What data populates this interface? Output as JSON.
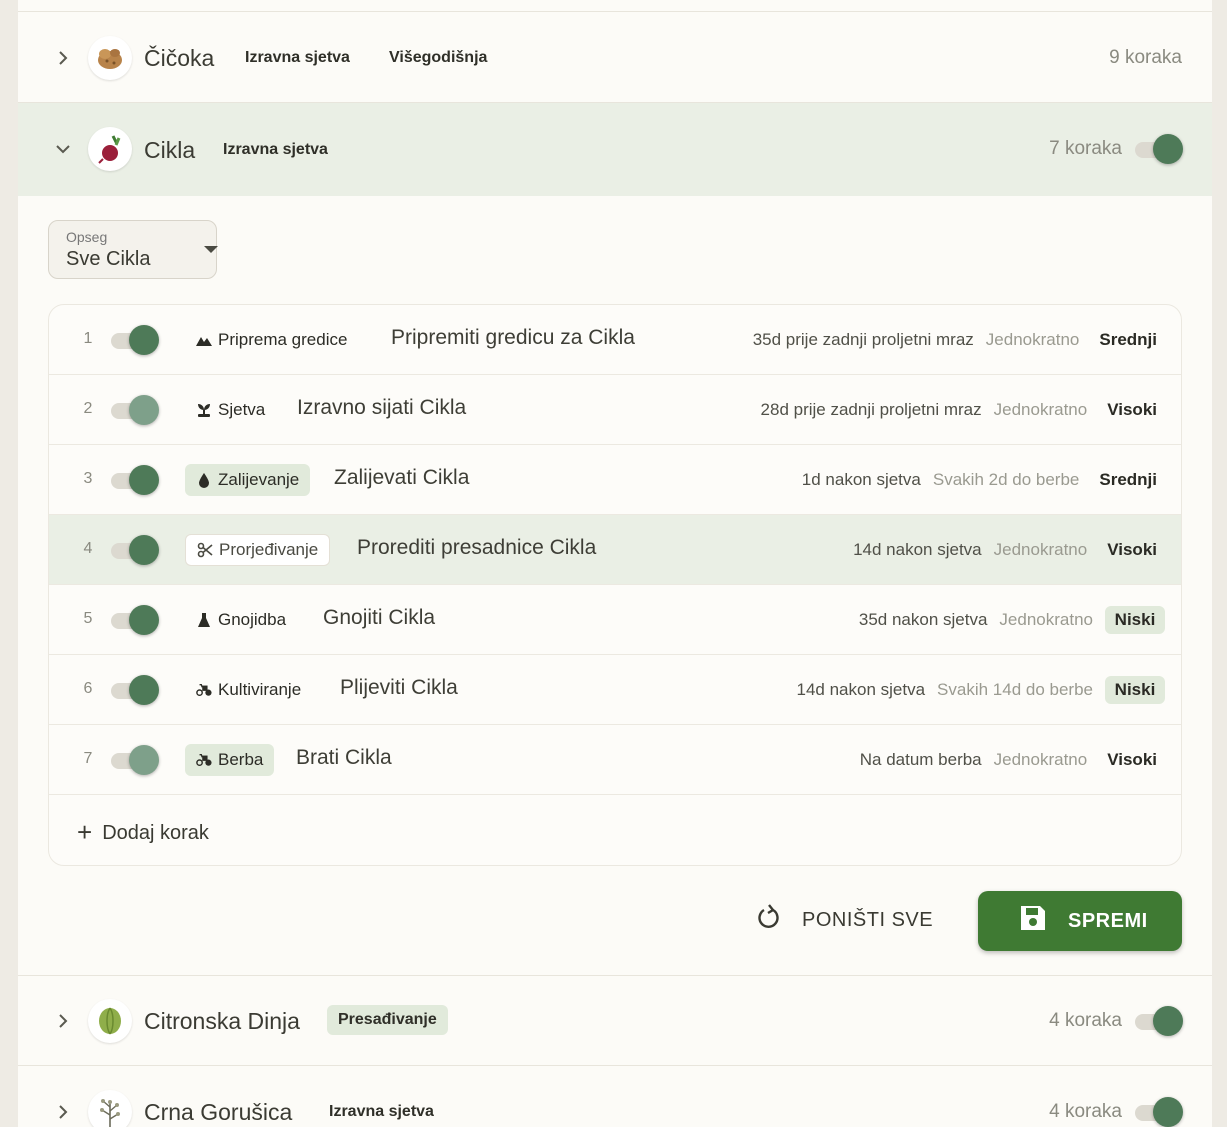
{
  "crops": [
    {
      "name": "Čičoka",
      "icon": "sunchoke-icon",
      "tags": [
        "Izravna sjetva",
        "Višegodišnja"
      ],
      "steps": "9 koraka",
      "expanded": false,
      "has_toggle": false
    },
    {
      "name": "Cikla",
      "icon": "beet-icon",
      "tags": [
        "Izravna sjetva"
      ],
      "steps": "7 koraka",
      "expanded": true,
      "has_toggle": true
    },
    {
      "name": "Citronska Dinja",
      "icon": "melon-icon",
      "tags": [
        "Presađivanje"
      ],
      "steps": "4 koraka",
      "expanded": false,
      "has_toggle": true
    },
    {
      "name": "Crna Gorušica",
      "icon": "mustard-plant-icon",
      "tags": [
        "Izravna sjetva"
      ],
      "steps": "4 koraka",
      "expanded": false,
      "has_toggle": true
    }
  ],
  "scope": {
    "label": "Opseg",
    "value": "Sve Cikla"
  },
  "steps": [
    {
      "num": "1",
      "enabled": true,
      "category": "Priprema gredice",
      "icon": "terrain-icon",
      "style": "plain",
      "title": "Pripremiti gredicu za Cikla",
      "timing": "35d prije zadnji proljetni mraz",
      "frequency": "Jednokratno",
      "priority": "Srednji",
      "priority_level": "medium"
    },
    {
      "num": "2",
      "enabled": true,
      "category": "Sjetva",
      "icon": "seedling-icon",
      "style": "plain",
      "title": "Izravno sijati Cikla",
      "timing": "28d prije zadnji proljetni mraz",
      "frequency": "Jednokratno",
      "priority": "Visoki",
      "priority_level": "high"
    },
    {
      "num": "3",
      "enabled": true,
      "category": "Zalijevanje",
      "icon": "water-drop-icon",
      "style": "pill",
      "title": "Zalijevati Cikla",
      "timing": "1d nakon sjetva",
      "frequency": "Svakih 2d do berbe",
      "priority": "Srednji",
      "priority_level": "medium"
    },
    {
      "num": "4",
      "enabled": true,
      "category": "Prorjeđivanje",
      "icon": "scissors-icon",
      "style": "outline",
      "title": "Prorediti presadnice Cikla",
      "timing": "14d nakon sjetva",
      "frequency": "Jednokratno",
      "priority": "Visoki",
      "priority_level": "high"
    },
    {
      "num": "5",
      "enabled": true,
      "category": "Gnojidba",
      "icon": "flask-icon",
      "style": "plain",
      "title": "Gnojiti Cikla",
      "timing": "35d nakon sjetva",
      "frequency": "Jednokratno",
      "priority": "Niski",
      "priority_level": "low"
    },
    {
      "num": "6",
      "enabled": true,
      "category": "Kultiviranje",
      "icon": "tractor-icon",
      "style": "plain",
      "title": "Plijeviti Cikla",
      "timing": "14d nakon sjetva",
      "frequency": "Svakih 14d do berbe",
      "priority": "Niski",
      "priority_level": "low"
    },
    {
      "num": "7",
      "enabled": true,
      "category": "Berba",
      "icon": "tractor-icon",
      "style": "pill",
      "title": "Brati Cikla",
      "timing": "Na datum berba",
      "frequency": "Jednokratno",
      "priority": "Visoki",
      "priority_level": "high"
    }
  ],
  "add_step_label": "Dodaj korak",
  "actions": {
    "reset_label": "PONIŠTI SVE",
    "save_label": "SPREMI"
  },
  "colors": {
    "accent": "#3f7a33",
    "toggle_on": "#4e7a58",
    "highlight": "#eaefe5",
    "pill": "#e1eadb"
  }
}
